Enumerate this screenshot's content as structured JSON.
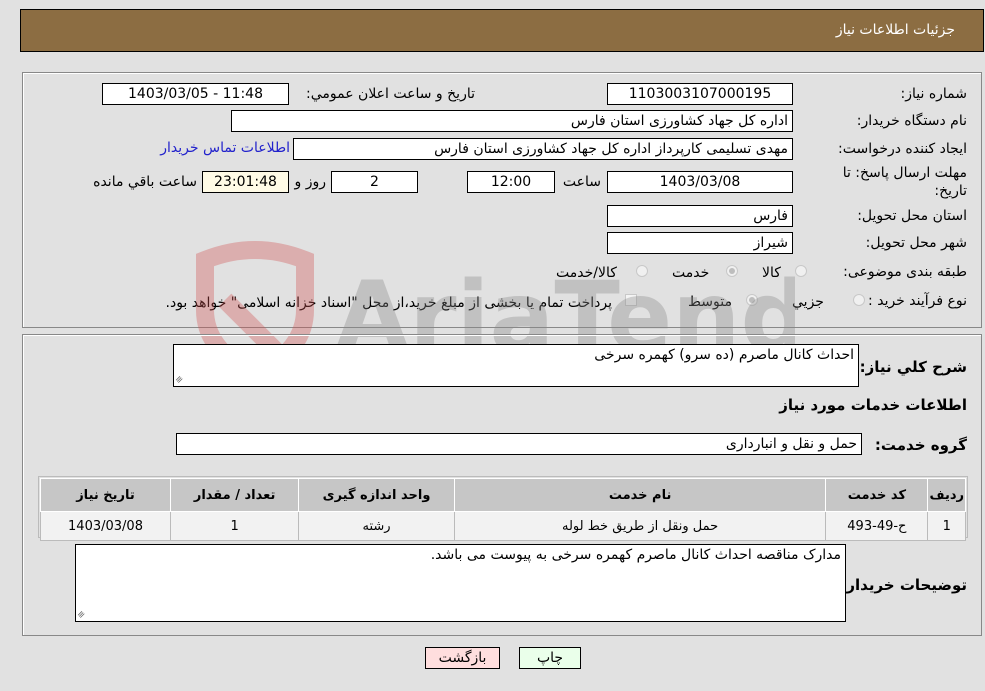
{
  "header": {
    "title": "جزئیات اطلاعات نیاز"
  },
  "form": {
    "need_number_label": "شماره نیاز:",
    "need_number": "1103003107000195",
    "announce_label": "تاریخ و ساعت اعلان عمومي:",
    "announce_value": "1403/03/05 - 11:48",
    "buyer_org_label": "نام دستگاه خریدار:",
    "buyer_org": "اداره کل جهاد کشاورزی استان فارس",
    "creator_label": "ایجاد کننده درخواست:",
    "creator": "مهدی تسلیمی کارپرداز اداره کل جهاد کشاورزی استان فارس",
    "contact_link": "اطلاعات تماس خریدار",
    "deadline_label": "مهلت ارسال پاسخ: تا تاریخ:",
    "deadline_date": "1403/03/08",
    "time_label": "ساعت",
    "deadline_time": "12:00",
    "days_value": "2",
    "days_label": "روز و",
    "remaining_time": "23:01:48",
    "remaining_label": "ساعت باقي مانده",
    "province_label": "استان محل تحویل:",
    "province": "فارس",
    "city_label": "شهر محل تحویل:",
    "city": "شیراز",
    "category_label": "طبقه بندی موضوعی:",
    "category_options": [
      "کالا",
      "خدمت",
      "کالا/خدمت"
    ],
    "category_selected": "خدمت",
    "process_label": "نوع فرآیند خرید :",
    "process_options": [
      "جزيي",
      "متوسط"
    ],
    "process_selected": "متوسط",
    "treasury_note": "پرداخت تمام یا بخشی از مبلغ خرید،از محل \"اسناد خزانه اسلامی\" خواهد بود."
  },
  "details": {
    "description_label": "شرح کلي نیاز:",
    "description": "احداث کانال ماصرم (ده سرو) کهمره سرخی",
    "services_heading": "اطلاعات خدمات مورد نیاز",
    "service_group_label": "گروه خدمت:",
    "service_group": "حمل و نقل و انبارداری",
    "table": {
      "headers": [
        "ردیف",
        "کد خدمت",
        "نام خدمت",
        "واحد اندازه گیری",
        "تعداد / مقدار",
        "تاریخ نیاز"
      ],
      "rows": [
        [
          "1",
          "ح-49-493",
          "حمل ونقل از طریق خط لوله",
          "رشته",
          "1",
          "1403/03/08"
        ]
      ]
    },
    "buyer_notes_label": "توضیحات خریدار:",
    "buyer_notes": "مدارک مناقصه احداث کانال ماصرم کهمره سرخی به پیوست می باشد."
  },
  "buttons": {
    "print": "چاپ",
    "back": "بازگشت"
  },
  "colors": {
    "header_bg": "#8c6d42",
    "print_bg": "#eaffea",
    "back_bg": "#ffdede",
    "link": "#2222cc"
  },
  "watermark": "AriaTender.neT"
}
